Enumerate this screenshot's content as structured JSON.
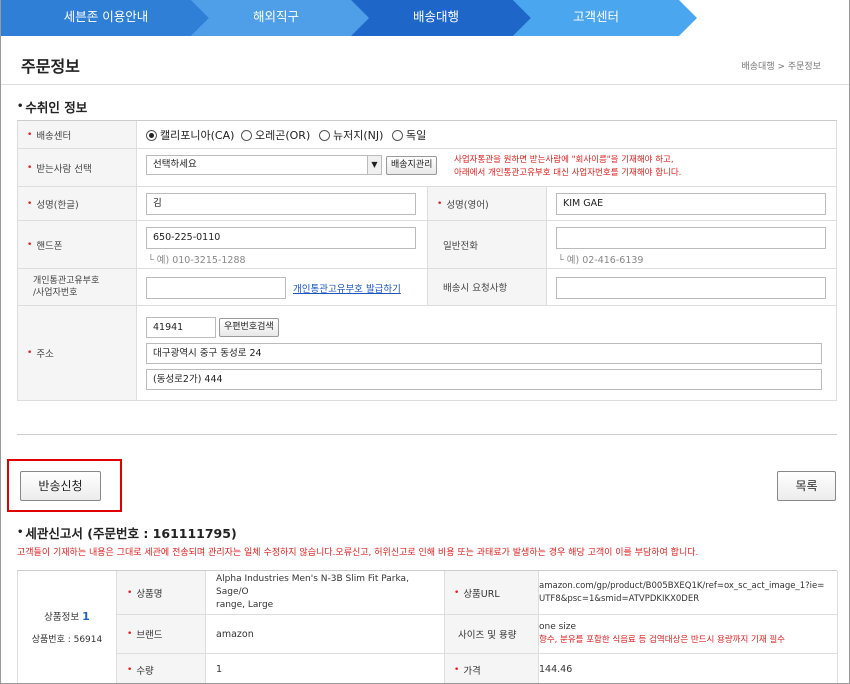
{
  "colors": {
    "nav_active": "#1e66c8",
    "nav_dark": "#2f7fd6",
    "nav_light": "#58aef0",
    "required": "#e02020",
    "link": "#1a55c0"
  },
  "nav": {
    "items": [
      "세븐존 이용안내",
      "해외직구",
      "배송대행",
      "고객센터"
    ]
  },
  "page": {
    "title": "주문정보",
    "breadcrumb": "배송대행 > 주문정보"
  },
  "recipient": {
    "section_title": "수취인 정보",
    "center_label": "배송센터",
    "centers": [
      {
        "label": "캘리포니아(CA)",
        "selected": true
      },
      {
        "label": "오레곤(OR)",
        "selected": false
      },
      {
        "label": "뉴저지(NJ)",
        "selected": false
      },
      {
        "label": "독일",
        "selected": false
      }
    ],
    "receiver_label": "받는사람 선택",
    "receiver_select": "선택하세요",
    "address_book_button": "배송지관리",
    "notice_line1": "사업자통관을 원하면 받는사람에 \"회사이름\"을 기재해야 하고,",
    "notice_line2": "아래에서 개인통관고유부호 대신 사업자번호를 기재해야 합니다.",
    "name_kr_label": "성명(한글)",
    "name_kr_value": "김",
    "name_en_label": "성명(영어)",
    "name_en_value": "KIM GAE",
    "mobile_label": "핸드폰",
    "mobile_value": "650-225-0110",
    "mobile_hint": "└ 예) 010-3215-1288",
    "phone_label": "일반전화",
    "phone_value": "",
    "phone_hint": "└ 예) 02-416-6139",
    "customs_label_1": "개인통관고유부호",
    "customs_label_2": "/사업자번호",
    "customs_value": "",
    "customs_link": "개인통관고유부호 발급하기",
    "request_label": "배송시 요청사항",
    "request_value": "",
    "address_label": "주소",
    "zipcode": "41941",
    "zipcode_button": "우편번호검색",
    "address1": "대구광역시 중구 동성로 24",
    "address2": "(동성로2가) 444"
  },
  "buttons": {
    "return_request": "반송신청",
    "list": "목록"
  },
  "customs": {
    "section_title": "세관신고서 (주문번호 : 161111795)",
    "notice": "고객들이 기재하는 내용은 그대로 세관에 전송되며 관리자는 일체 수정하지 않습니다.오류신고, 허위신고로 인해 비용 또는 과태료가 발생하는 경우 해당 고객이 이를 부담하여 합니다.",
    "product_info": "상품정보",
    "product_index": "1",
    "product_no": "상품번호 : 56914",
    "product_name_label": "상품명",
    "product_name_1": "Alpha Industries Men's N-3B Slim Fit Parka, Sage/O",
    "product_name_2": "range, Large",
    "product_url_label": "상품URL",
    "product_url_1": "amazon.com/gp/product/B005BXEQ1K/ref=ox_sc_act_image_1?ie=",
    "product_url_2": "UTF8&psc=1&smid=ATVPDKIKX0DER",
    "brand_label": "브랜드",
    "brand_value": "amazon",
    "size_label": "사이즈 및 용량",
    "size_value": "one size",
    "size_note": "향수, 분유를 포함한 식음료 등 검역대상은 반드시 용량까지 기재 필수",
    "qty_label": "수량",
    "qty_value": "1",
    "price_label": "가격",
    "price_value": "144.46"
  }
}
